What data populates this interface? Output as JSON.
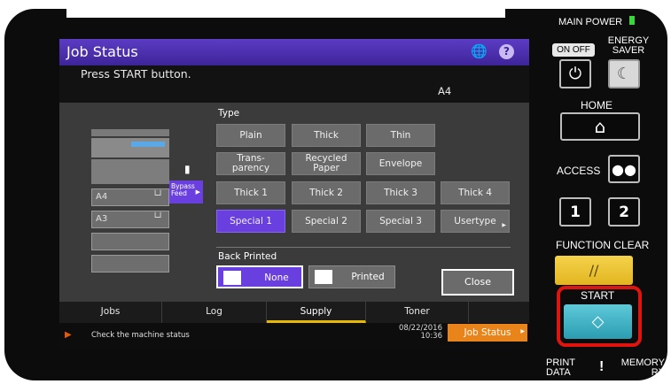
{
  "screen": {
    "title": "Job Status",
    "message": "Press START button.",
    "paper_size": "A4",
    "type_label": "Type",
    "back_printed_label": "Back Printed",
    "bypass_label": "Bypass Feed",
    "trays": [
      "A4",
      "A3"
    ],
    "paper_types": [
      [
        "Plain",
        "Thick",
        "Thin"
      ],
      [
        "Trans- parency",
        "Recycled Paper",
        "Envelope"
      ],
      [
        "Thick 1",
        "Thick 2",
        "Thick 3",
        "Thick 4"
      ],
      [
        "Special 1",
        "Special 2",
        "Special 3",
        "Usertype"
      ]
    ],
    "selected_type": "Special 1",
    "back_printed_options": [
      "None",
      "Printed"
    ],
    "selected_back_printed": "None",
    "close_label": "Close",
    "tabs": [
      "Jobs",
      "Log",
      "Supply",
      "Toner"
    ],
    "active_tab": "Supply",
    "status_message": "Check the machine status",
    "date": "08/22/2016",
    "time": "10:36",
    "job_status_button": "Job Status"
  },
  "control_panel": {
    "main_power": "MAIN POWER",
    "on_off": "ON OFF",
    "energy_saver": "ENERGY SAVER",
    "home": "HOME",
    "access": "ACCESS",
    "key_1": "1",
    "key_2": "2",
    "function_clear": "FUNCTION CLEAR",
    "start": "START",
    "print_data": "PRINT DATA",
    "memory_rx": "MEMORY RX",
    "accent_start": "#3db2c7",
    "accent_clear": "#f0c93a",
    "highlight": "#e0140f"
  }
}
